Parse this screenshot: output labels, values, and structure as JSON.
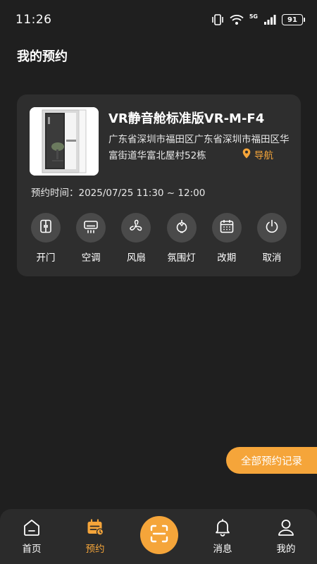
{
  "status_bar": {
    "time": "11:26",
    "network": "5G",
    "battery": "91"
  },
  "page": {
    "title": "我的预约"
  },
  "booking": {
    "room_name": "VR静音舱标准版VR-M-F4",
    "address": "广东省深圳市福田区广东省深圳市福田区华富街道华富北屋村52栋",
    "navigate_label": "导航",
    "time_label": "预约时间：",
    "time_value": "2025/07/25 11:30 ~ 12:00",
    "controls": [
      {
        "label": "开门",
        "icon": "door-icon"
      },
      {
        "label": "空调",
        "icon": "air-conditioner-icon"
      },
      {
        "label": "风扇",
        "icon": "fan-icon"
      },
      {
        "label": "氛围灯",
        "icon": "ambient-light-icon"
      },
      {
        "label": "改期",
        "icon": "calendar-icon"
      },
      {
        "label": "取消",
        "icon": "power-icon"
      }
    ]
  },
  "history_button": {
    "label": "全部预约记录"
  },
  "bottom_nav": {
    "tabs": [
      {
        "label": "首页",
        "icon": "home-icon"
      },
      {
        "label": "预约",
        "icon": "booking-calendar-icon",
        "active": true
      },
      {
        "label": "消息",
        "icon": "bell-icon"
      },
      {
        "label": "我的",
        "icon": "user-icon"
      }
    ],
    "scan_icon": "scan-icon"
  },
  "colors": {
    "background": "#1f1f1f",
    "card": "#2e2e2e",
    "accent": "#f5a53a",
    "control_circle": "#4a4a4a"
  }
}
